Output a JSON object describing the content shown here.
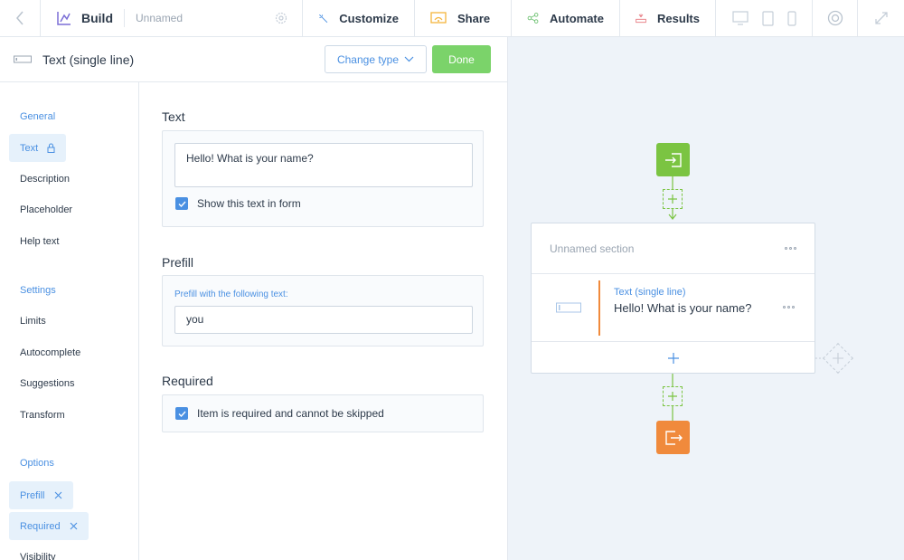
{
  "topbar": {
    "build_label": "Build",
    "form_name": "Unnamed",
    "tabs": [
      {
        "label": "Customize",
        "icon": "wand-icon"
      },
      {
        "label": "Share",
        "icon": "share-icon"
      },
      {
        "label": "Automate",
        "icon": "automate-icon"
      },
      {
        "label": "Results",
        "icon": "results-icon"
      }
    ]
  },
  "editor": {
    "field_type_title": "Text (single line)",
    "change_type_label": "Change type",
    "done_label": "Done"
  },
  "sidebar": {
    "general_label": "General",
    "general_items": [
      "Text",
      "Description",
      "Placeholder",
      "Help text"
    ],
    "settings_label": "Settings",
    "settings_items": [
      "Limits",
      "Autocomplete",
      "Suggestions",
      "Transform"
    ],
    "options_label": "Options",
    "options_items": [
      "Prefill",
      "Required",
      "Visibility"
    ]
  },
  "form": {
    "text_title": "Text",
    "text_value": "Hello! What is your name?",
    "show_text_label": "Show this text in form",
    "prefill_title": "Prefill",
    "prefill_sublabel": "Prefill with the following text:",
    "prefill_value": "you",
    "required_title": "Required",
    "required_label": "Item is required and cannot be skipped"
  },
  "canvas": {
    "section_name": "Unnamed section",
    "block_type": "Text (single line)",
    "block_text": "Hello! What is your name?"
  },
  "colors": {
    "accent": "#4a90e2",
    "done_green": "#7bd36a",
    "start_green": "#7bc442",
    "end_orange": "#f08a3c",
    "canvas_bg": "#eef3f9"
  }
}
